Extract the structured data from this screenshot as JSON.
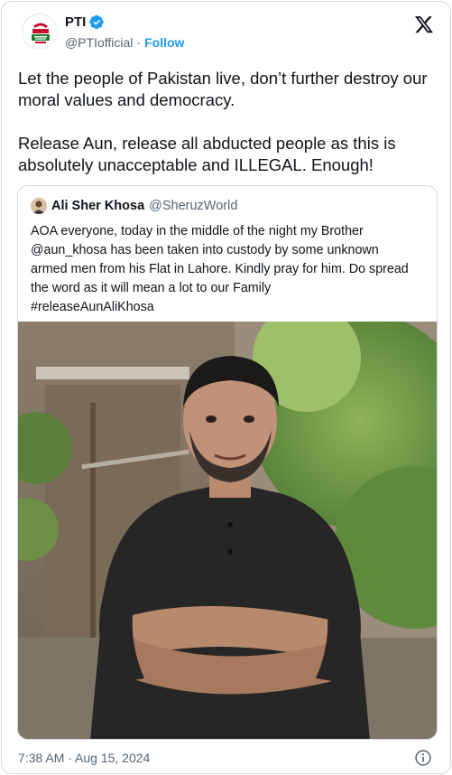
{
  "author": {
    "display_name": "PTI",
    "handle": "@PTIofficial",
    "separator": "·",
    "follow_label": "Follow"
  },
  "tweet": {
    "paragraphs": [
      "Let the people of Pakistan live, don’t further destroy our moral values and democracy.",
      "Release Aun, release all abducted people as this is absolutely unacceptable and ILLEGAL. Enough!"
    ],
    "timestamp": "7:38 AM · Aug 15, 2024"
  },
  "quoted_tweet": {
    "display_name": "Ali Sher Khosa",
    "handle": "@SheruzWorld",
    "lines": [
      "AOA everyone, today in the middle of the night my Brother",
      "@aun_khosa has been taken into custody by some unknown",
      "armed men from his Flat in Lahore. Kindly pray for him. Do spread",
      "the word as it will mean a lot to our Family",
      "#releaseAunAliKhosa"
    ]
  },
  "icons": {
    "verified": "verified-badge-icon",
    "brand": "x-logo-icon",
    "info": "info-icon"
  },
  "colors": {
    "accent": "#1d9bf0",
    "text": "#0f1419",
    "muted": "#536471",
    "border": "#cfd9de"
  }
}
